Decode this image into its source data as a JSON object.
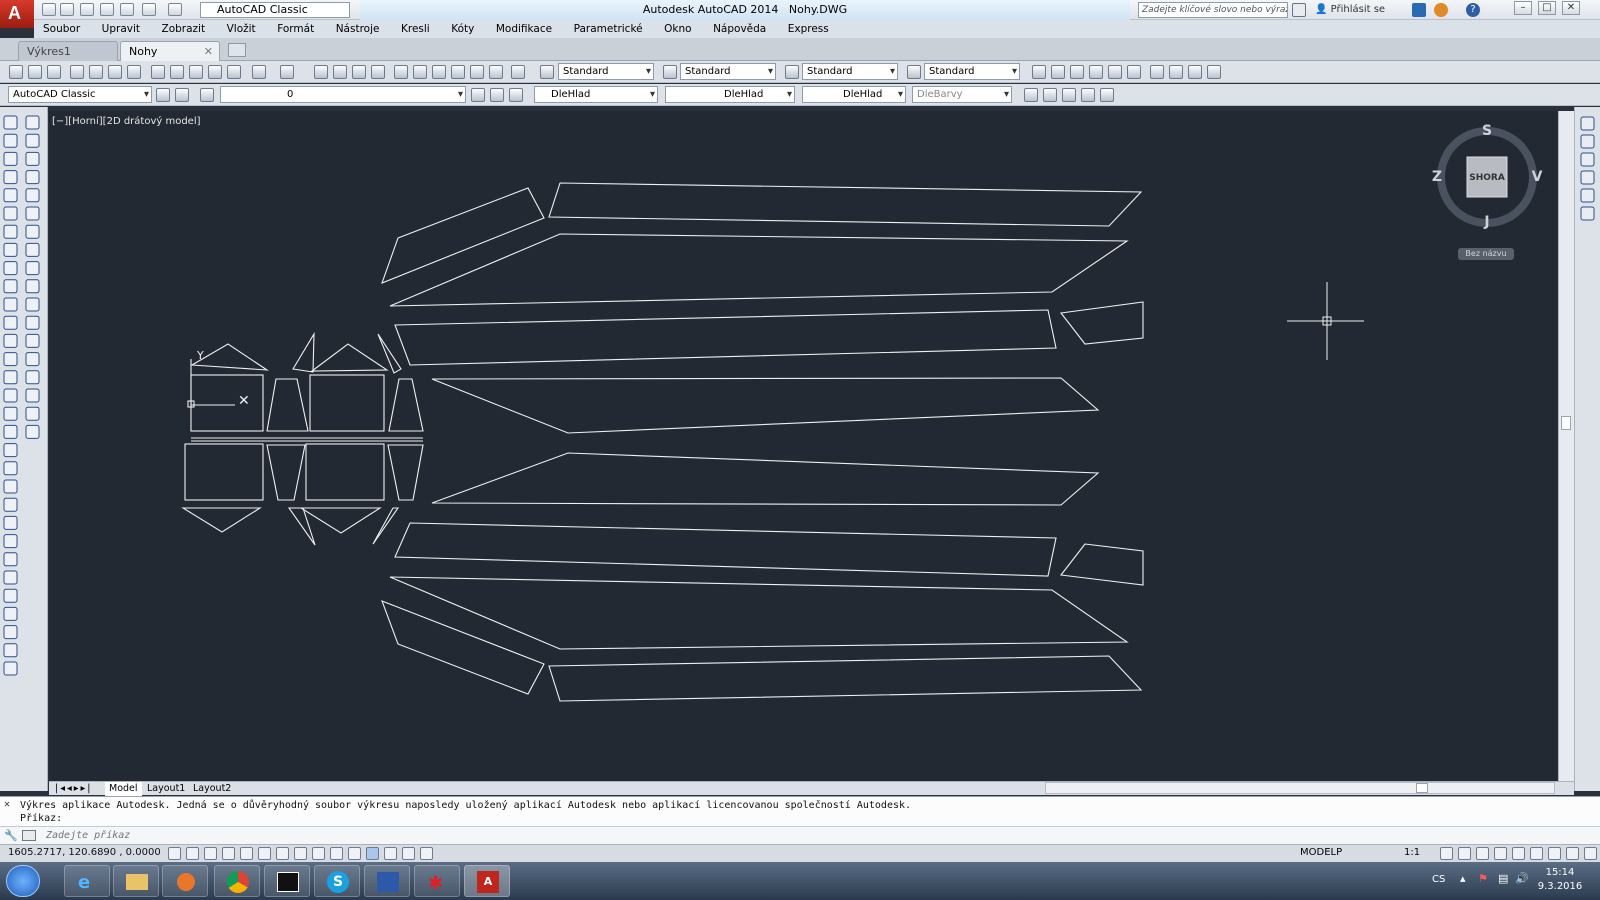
{
  "app": {
    "title": "Autodesk AutoCAD 2014",
    "file": "Nohy.DWG",
    "workspace": "AutoCAD Classic",
    "search_placeholder": "Zadejte klíčové slovo nebo výraz",
    "signin": "Přihlásit se"
  },
  "menu": [
    "Soubor",
    "Upravit",
    "Zobrazit",
    "Vložit",
    "Formát",
    "Nástroje",
    "Kresli",
    "Kóty",
    "Modifikace",
    "Parametrické",
    "Okno",
    "Nápověda",
    "Express"
  ],
  "tabs": [
    {
      "label": "Výkres1"
    },
    {
      "label": "Nohy"
    }
  ],
  "styles": {
    "text": "Standard",
    "dim": "Standard",
    "table": "Standard",
    "mleader": "Standard"
  },
  "layers": {
    "workspace": "AutoCAD Classic",
    "layer": "0",
    "color": "DleHlad",
    "linetype": "DleHlad",
    "lineweight": "DleHlad",
    "plotstyle": "DleBarvy"
  },
  "viewport": {
    "label": "[−][Horní][2D drátový model]"
  },
  "viewcube": {
    "north": "S",
    "south": "J",
    "west": "Z",
    "east": "V",
    "face": "SHORA",
    "ucs": "Bez názvu"
  },
  "layout_tabs": [
    "Model",
    "Layout1",
    "Layout2"
  ],
  "command": {
    "history_1": "Výkres aplikace Autodesk. Jedná se o důvěryhodný soubor výkresu naposledy uložený aplikací Autodesk nebo aplikací licencovanou společností Autodesk.",
    "history_2": "Příkaz:",
    "placeholder": "Zadejte příkaz"
  },
  "status": {
    "coords": "1605.2717, 120.6890 , 0.0000",
    "space": "MODELP",
    "scale": "1:1"
  },
  "taskbar": {
    "lang": "CS",
    "time": "15:14",
    "date": "9.3.2016"
  },
  "colors": {
    "viewport_bg": "#222932",
    "line": "#ffffff",
    "accent": "#c0261c"
  }
}
